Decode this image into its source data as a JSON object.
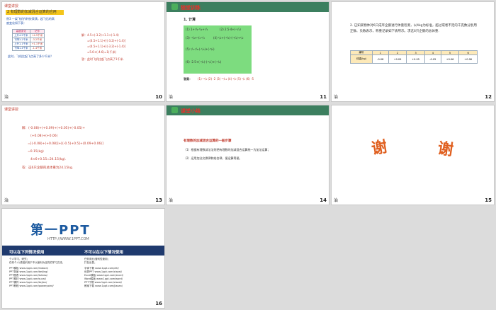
{
  "slides": {
    "s10": {
      "number": "10",
      "corner": "课堂讲授",
      "heading": "2 有理数的加减混合运算的应用",
      "problem": "例3 一架飞机作特技表演，起飞后的高度变化如下表：",
      "table": [
        [
          "高度变化",
          "记作"
        ],
        [
          "上升4.5千米",
          "+4.5千米"
        ],
        [
          "下降3.2千米",
          "-3.2千米"
        ],
        [
          "上升1.1千米",
          "+1.1千米"
        ],
        [
          "下降1.4千米",
          "-1.4千米"
        ]
      ],
      "question": "此时，飞机比起飞点高了多少千米？",
      "solution": [
        "解：4.5+(-3.2)+1.1+(-1.4)",
        "=(4.5+1.1)+[(-3.2)+(-1.4)]",
        "=(4.5+1.1)+[(-3.2)+(-1.4)]",
        "=5.6+(-4.6)=1(千米)"
      ],
      "answer": "答：此时飞机比起飞点高了1千米.",
      "bottom_left": "治"
    },
    "s11": {
      "number": "11",
      "title": "随堂训练",
      "item": "1. 计算",
      "exprs": [
        "(1) 1+¹/₂-¹/₂+¹/₄",
        "(2) 2.5-4+(-¹/₂)",
        "(3) -¹/₂+¹/₄-²/₃",
        "(4) ¹/₂+(-²/₃)-(-³/₄)+¹/₂",
        "(5) ²/₃-¹/₈-(-¹/₃)+(-³/₈)",
        "(6) -2.5+(-³/₂)-(-¹/₂)+(-¹/₂)"
      ],
      "answers_label": "答案：",
      "answers": "(1) ¹¹/₄   (2) -2   (3) ⁷⁷/₁₂   (4) ²/₃   (5) ¹/₂   (6) -5",
      "bottom_left": "治"
    },
    "s12": {
      "number": "12",
      "text": "2. 已知某物体对6只成年企鹅进行体重检测，以4kg为标准，超过或者不足的千克数分别用正数、负数表示，称重记录如下表所示。求这6只企鹅的总体重.",
      "table_head": [
        "编号",
        "1",
        "2",
        "3",
        "4",
        "5",
        "6"
      ],
      "table_row": [
        "体重(kg)",
        "-0.08",
        "+0.09",
        "+0.05",
        "-0.05",
        "+0.06",
        "+0.06"
      ],
      "bottom_left": "治"
    },
    "s13": {
      "number": "13",
      "corner": "课堂讲授",
      "lines": [
        "解：(-0.08)+(+0.09)+(+0.05)+(-0.05)+",
        "(+0.08)+(+0.06)",
        "=[(-0.08)+(+0.08)]+[(-0.5)+0.5]+(0.09+0.06)]",
        "=0.15(kg)",
        "4×6+0.15=24.15(kg)."
      ],
      "answer": "答：这6只企鹅的总体重为24.15kg.",
      "bottom_left": "治"
    },
    "s14": {
      "number": "14",
      "title": "课堂小结",
      "subtitle": "有理数的加减混合运算的一般步骤",
      "points": [
        "（1）根据有理数减法法则把有理数的加减混合运算统一为加法运算；",
        "（2）运用加法交换律和结合律，便运算简便。"
      ],
      "bottom_left": "治"
    },
    "s15": {
      "number": "15",
      "thanks": [
        "谢",
        "谢"
      ],
      "bottom_left": "治"
    },
    "s16": {
      "number": "16",
      "logo": "第一PPT",
      "url": "HTTP://WWW.1PPT.COM",
      "left_head": "可以在下列情况使用",
      "right_head": "不可以在以下情况使用",
      "left_lines": [
        "个人学习、研究；",
        "任何个人/或组织用于不以营利为目的的学习交流。"
      ],
      "right_lines": [
        "任何商业/营利性使用；",
        "打包出售。"
      ],
      "links_left": [
        "PPT模板 www.1ppt.com/moban/",
        "PPT背景 www.1ppt.com/beijing/",
        "PPT图表 www.1ppt.com/tubiao/",
        "PPT素材 www.1ppt.com/sucai/",
        "PPT课件 www.1ppt.com/kejian/",
        "PPT教程 www.1ppt.com/powerpoint/"
      ],
      "links_right": [
        "字体下载 www.1ppt.com/ziti/",
        "优秀PPT www.1ppt.com/xiazai/",
        "Excel模板 www.1ppt.com/excel/",
        "Word模板 www.1ppt.com/word/",
        "PPT下载 www.1ppt.com/xiazai/",
        "教案下载 www.1ppt.com/jiaoan/"
      ]
    }
  },
  "colors": {
    "accent_red": "#c0392b",
    "green_head": "#3c7f5f",
    "yellow_bar": "#f4c51b",
    "green_box": "#7ddc7f",
    "orange": "#e06020"
  }
}
